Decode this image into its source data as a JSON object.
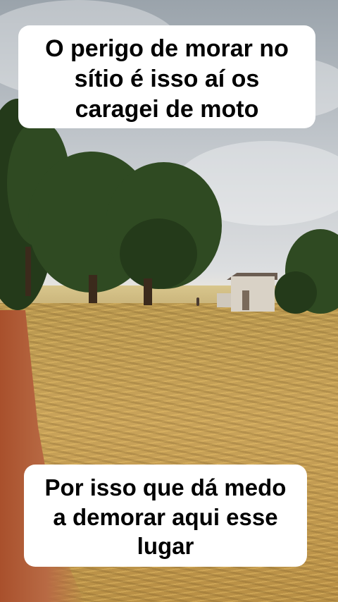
{
  "captions": {
    "top": [
      "O perigo de morar no",
      "sítio é isso aí os",
      "caragei de moto"
    ],
    "bottom": [
      "Por isso que dá medo",
      "a demorar aqui esse",
      "lugar"
    ]
  }
}
